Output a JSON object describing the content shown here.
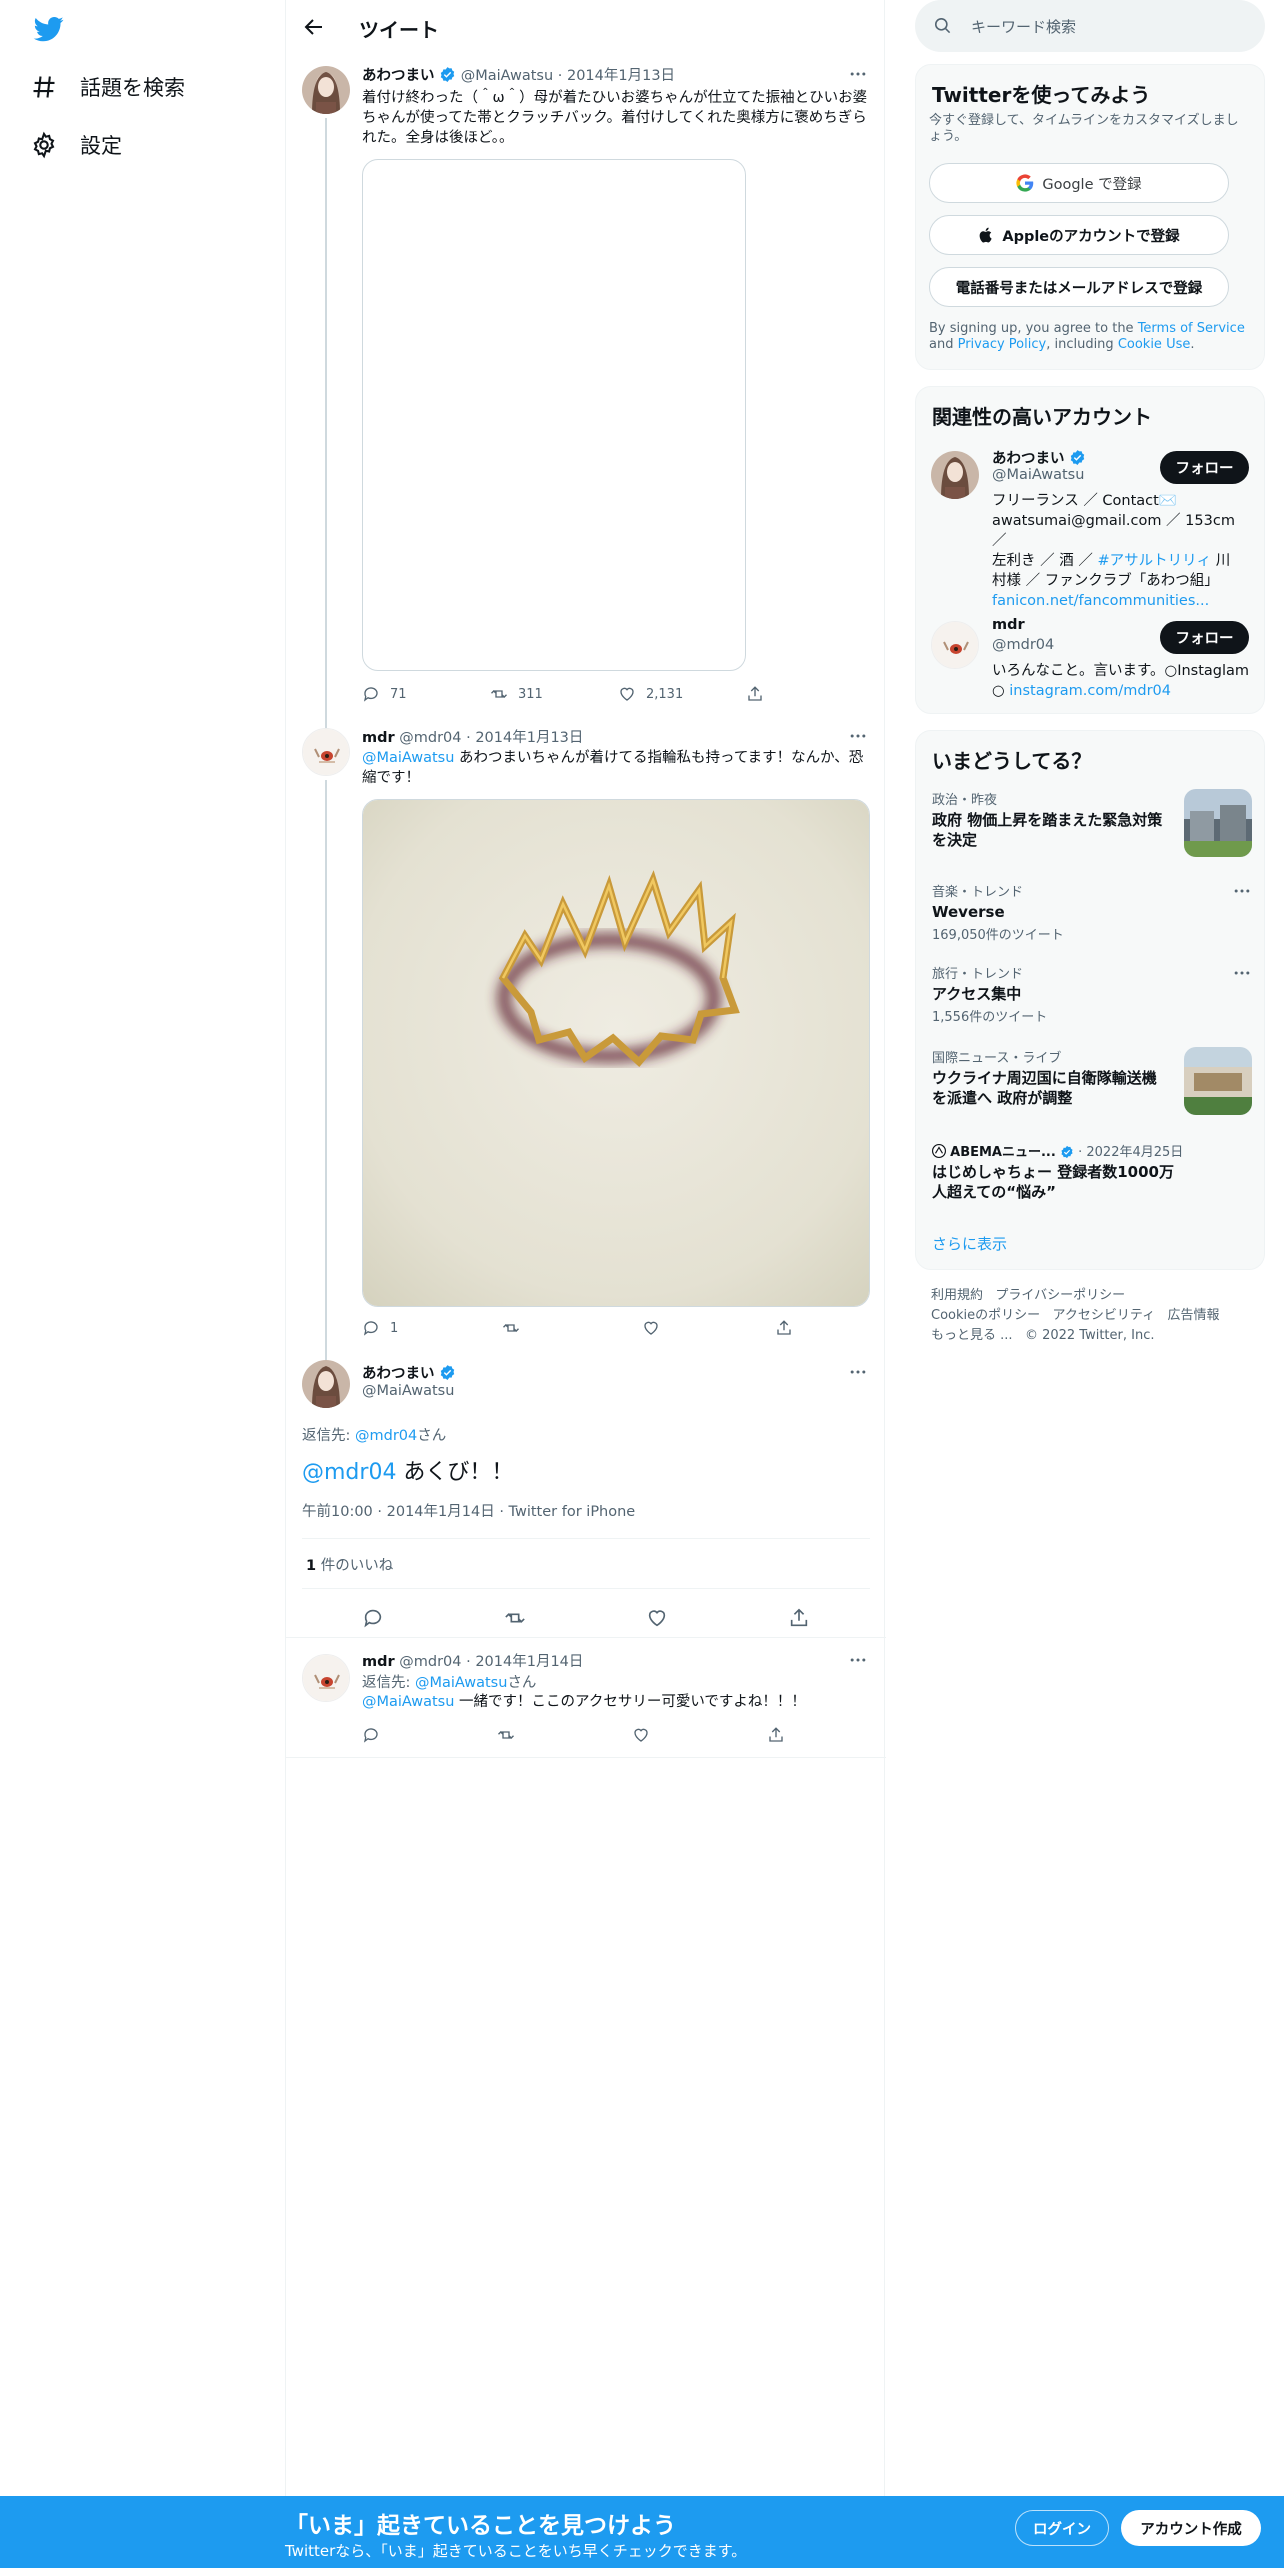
{
  "nav": {
    "explore": "話題を検索",
    "settings": "設定"
  },
  "header": {
    "title": "ツイート"
  },
  "tweet1": {
    "name": "あわつまい",
    "handle": "@MaiAwatsu",
    "date": "2014年1月13日",
    "text": "着付け終わった（＾ω＾）母が着たひいお婆ちゃんが仕立てた振袖とひいお婆ちゃんが使ってた帯とクラッチバック。着付けしてくれた奥様方に褒めちぎられた。全身は後ほど。。",
    "replies": "71",
    "retweets": "311",
    "likes": "2,131"
  },
  "tweet2": {
    "name": "mdr",
    "handle": "@mdr04",
    "date": "2014年1月13日",
    "mention": "@MaiAwatsu",
    "text": " あわつまいちゃんが着けてる指輪私も持ってます！なんか、恐縮です！",
    "replies": "1"
  },
  "main_tweet": {
    "name": "あわつまい",
    "handle": "@MaiAwatsu",
    "reply_to_label": "返信先: ",
    "reply_to_handle": "@mdr04",
    "reply_to_suffix": "さん",
    "mention": "@mdr04",
    "text": " あくび！！",
    "time": "午前10:00",
    "date": "2014年1月14日",
    "source": "Twitter for iPhone",
    "likes_count": "1",
    "likes_label": " 件のいいね"
  },
  "tweet4": {
    "name": "mdr",
    "handle": "@mdr04",
    "date": "2014年1月14日",
    "reply_to_label": "返信先: ",
    "reply_to_handle": "@MaiAwatsu",
    "reply_to_suffix": "さん",
    "mention": "@MaiAwatsu",
    "text": " 一緒です！ここのアクセサリー可愛いですよね！！！"
  },
  "search": {
    "placeholder": "キーワード検索"
  },
  "signup_card": {
    "title": "Twitterを使ってみよう",
    "subtitle": "今すぐ登録して、タイムラインをカスタマイズしましょう。",
    "google": "Google で登録",
    "apple": "Appleのアカウントで登録",
    "phone": "電話番号またはメールアドレスで登録",
    "terms_pre": "By signing up, you agree to the ",
    "terms": "Terms of Service",
    "terms_and": " and ",
    "privacy": "Privacy Policy",
    "including": ", including ",
    "cookie": "Cookie Use",
    "period": "."
  },
  "related": {
    "title": "関連性の高いアカウント",
    "accounts": [
      {
        "name": "あわつまい",
        "handle": "@MaiAwatsu",
        "follow": "フォロー",
        "bio_a": "フリーランス ／ Contact✉️",
        "bio_b": "awatsumai@gmail.com ／ 153cm ／",
        "bio_c1": "左利き ／ 酒 ／ ",
        "bio_c2": "#アサルトリリィ",
        "bio_c3": " 川",
        "bio_d": "村様 ／ ファンクラブ「あわつ組」",
        "bio_e": "fanicon.net/fancommunities..."
      },
      {
        "name": "mdr",
        "handle": "@mdr04",
        "follow": "フォロー",
        "bio_a": "いろんなこと。言います。○Instaglam",
        "bio_b1": "○ ",
        "bio_b2": "instagram.com/mdr04"
      }
    ]
  },
  "trends": {
    "title": "いまどうしてる？",
    "items": [
      {
        "meta": "政治・昨夜",
        "name_l1": "政府 物価上昇を踏まえた緊急対策",
        "name_l2": "を決定"
      },
      {
        "meta": "音楽・トレンド",
        "name": "Weverse",
        "count": "169,050件のツイート"
      },
      {
        "meta": "旅行・トレンド",
        "name": "アクセス集中",
        "count": "1,556件のツイート"
      },
      {
        "meta": "国際ニュース・ライブ",
        "name_l1": "ウクライナ周辺国に自衛隊輸送機",
        "name_l2": "を派遣へ 政府が調整"
      },
      {
        "source": "ABEMAニュー...",
        "date": "2022年4月25日",
        "name_l1": "はじめしゃちょー 登録者数1000万",
        "name_l2": "人超えての“悩み”"
      }
    ],
    "show_more": "さらに表示"
  },
  "footer": {
    "l1a": "利用規約",
    "l1b": "プライバシーポリシー",
    "l2a": "Cookieのポリシー",
    "l2b": "アクセシビリティ",
    "l2c": "広告情報",
    "l3a": "もっと見る ...",
    "l3b": "© 2022 Twitter, Inc."
  },
  "banner": {
    "title": "「いま」起きていることを見つけよう",
    "subtitle": "Twitterなら、「いま」起きていることをいち早くチェックできます。",
    "login": "ログイン",
    "signup": "アカウント作成"
  },
  "colors": {
    "accent": "#1d9bf0",
    "text": "#0f1419",
    "secondary": "#536471"
  }
}
